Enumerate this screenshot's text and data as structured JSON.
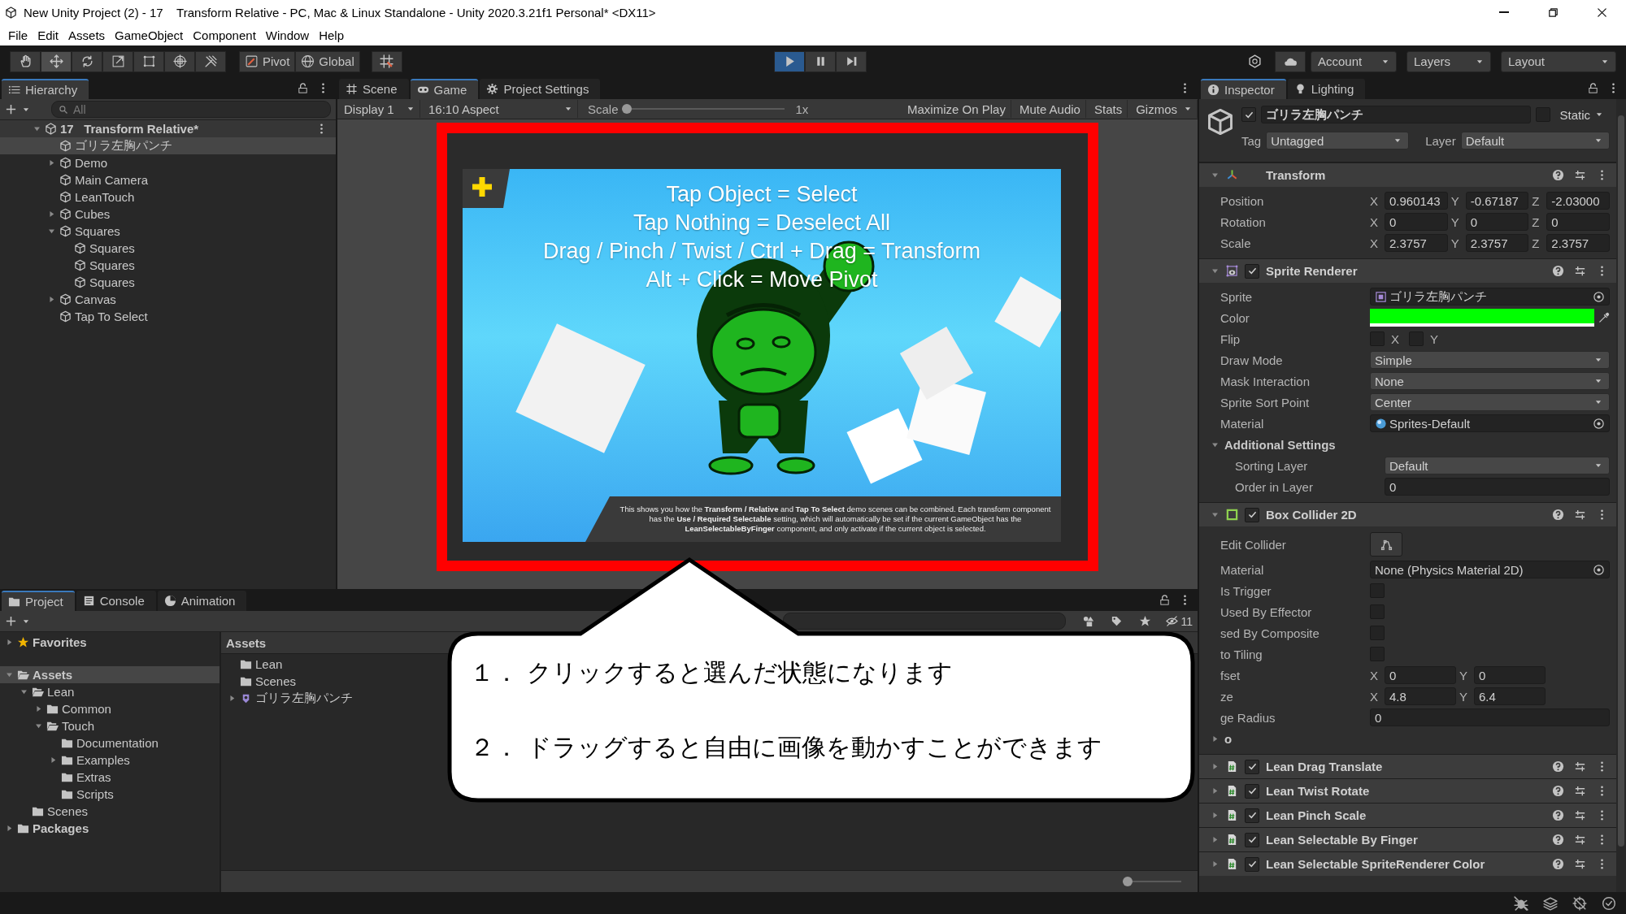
{
  "window": {
    "title": "New Unity Project (2) - 17    Transform Relative - PC, Mac & Linux Standalone - Unity 2020.3.21f1 Personal* <DX11>"
  },
  "menu": [
    "File",
    "Edit",
    "Assets",
    "GameObject",
    "Component",
    "Window",
    "Help"
  ],
  "toolbar": {
    "tools": [
      {
        "kind": "hand",
        "selected": false
      },
      {
        "kind": "move",
        "selected": true
      },
      {
        "kind": "rotate",
        "selected": false
      },
      {
        "kind": "scale",
        "selected": false
      },
      {
        "kind": "rect",
        "selected": false
      },
      {
        "kind": "transform",
        "selected": false
      },
      {
        "kind": "tools",
        "selected": false
      }
    ],
    "pivot": "Pivot",
    "global": "Global",
    "playing": true,
    "account": "Account",
    "layers": "Layers",
    "layout": "Layout"
  },
  "hierarchy": {
    "tab": "Hierarchy",
    "search": {
      "placeholder": "All"
    },
    "scene": {
      "name": "17   Transform Relative*",
      "expanded": true
    },
    "items": [
      {
        "name": "ゴリラ左胸パンチ",
        "selected": true
      },
      {
        "name": "Demo",
        "expanded": false,
        "selected": false
      },
      {
        "name": "Main Camera",
        "selected": false
      },
      {
        "name": "LeanTouch",
        "selected": false
      },
      {
        "name": "Cubes",
        "expanded": false,
        "selected": false
      },
      {
        "name": "Squares",
        "expanded": true,
        "selected": false,
        "children": [
          {
            "name": "Squares",
            "selected": false
          },
          {
            "name": "Squares",
            "selected": false
          },
          {
            "name": "Squares",
            "selected": false
          }
        ]
      },
      {
        "name": "Canvas",
        "expanded": false,
        "selected": false
      },
      {
        "name": "Tap To Select",
        "selected": false
      }
    ]
  },
  "view": {
    "tabs": [
      {
        "label": "Scene",
        "kind": "scene",
        "selected": false
      },
      {
        "label": "Game",
        "kind": "game",
        "selected": true
      },
      {
        "label": "Project Settings",
        "kind": "settings",
        "selected": false
      }
    ],
    "display": "Display 1",
    "aspect": "16:10 Aspect",
    "scale": {
      "label": "Scale",
      "level": 0,
      "reading": "1x"
    },
    "toggles": [
      {
        "label": "Maximize On Play",
        "on": false
      },
      {
        "label": "Mute Audio",
        "on": false
      },
      {
        "label": "Stats",
        "on": false
      },
      {
        "label": "Gizmos",
        "on": false
      }
    ],
    "game": {
      "headline": [
        "Tap Object = Select",
        "Tap Nothing = Deselect All",
        "Drag / Pinch / Twist / Ctrl + Drag = Transform",
        "Alt + Click = Move Pivot"
      ],
      "info": "This shows you how the **Transform / Relative** and **Tap To Select** demo scenes can be combined. Each transform component has the **Use / Required Selectable** setting, which will automatically be set if the current GameObject has the **LeanSelectableByFinger** component, and only activate if the current object is selected."
    }
  },
  "project": {
    "tabs": [
      {
        "label": "Project",
        "kind": "folder",
        "selected": true
      },
      {
        "label": "Console",
        "kind": "console",
        "selected": false
      },
      {
        "label": "Animation",
        "kind": "clock",
        "selected": false
      }
    ],
    "hidden_count": "11",
    "tree": [
      {
        "name": "Favorites",
        "kind": "favorites",
        "expanded": false,
        "selected": false
      },
      {
        "name": "Assets",
        "kind": "folder",
        "expanded": true,
        "selected": true,
        "children": [
          {
            "name": "Lean",
            "kind": "folder",
            "expanded": true,
            "selected": false,
            "children": [
              {
                "name": "Common",
                "kind": "folder",
                "expanded": false,
                "selected": false
              },
              {
                "name": "Touch",
                "kind": "folder",
                "expanded": true,
                "selected": false,
                "children": [
                  {
                    "name": "Documentation",
                    "kind": "folder",
                    "selected": false
                  },
                  {
                    "name": "Examples",
                    "kind": "folder",
                    "expanded": false,
                    "selected": false
                  },
                  {
                    "name": "Extras",
                    "kind": "folder",
                    "selected": false
                  },
                  {
                    "name": "Scripts",
                    "kind": "folder",
                    "selected": false
                  }
                ]
              }
            ]
          },
          {
            "name": "Scenes",
            "kind": "folder",
            "selected": false
          }
        ]
      },
      {
        "name": "Packages",
        "kind": "folder",
        "expanded": false,
        "selected": false
      }
    ],
    "breadcrumb": "Assets",
    "assets": [
      {
        "name": "Lean",
        "kind": "folder"
      },
      {
        "name": "Scenes",
        "kind": "folder"
      },
      {
        "name": "ゴリラ左胸パンチ",
        "kind": "sprite",
        "expanded": false
      }
    ],
    "zoom": {
      "level": 0
    }
  },
  "inspector": {
    "tabs": [
      {
        "label": "Inspector",
        "kind": "info",
        "selected": true
      },
      {
        "label": "Lighting",
        "kind": "bulb",
        "selected": false
      }
    ],
    "object": {
      "active": true,
      "name": "ゴリラ左胸パンチ",
      "static": false,
      "static_label": "Static",
      "tag_label": "Tag",
      "tag": "Untagged",
      "layer_label": "Layer",
      "layer": "Default"
    },
    "components": [
      {
        "name": "Transform",
        "kind": "transform",
        "expanded": true,
        "properties": [
          {
            "label": "Position",
            "kind": "vector",
            "fields": [
              {
                "axis": "X",
                "value": "0.960143"
              },
              {
                "axis": "Y",
                "value": "-0.67187"
              },
              {
                "axis": "Z",
                "value": "-2.03000"
              }
            ]
          },
          {
            "label": "Rotation",
            "kind": "vector",
            "fields": [
              {
                "axis": "X",
                "value": "0"
              },
              {
                "axis": "Y",
                "value": "0"
              },
              {
                "axis": "Z",
                "value": "0"
              }
            ]
          },
          {
            "label": "Scale",
            "kind": "vector",
            "fields": [
              {
                "axis": "X",
                "value": "2.3757"
              },
              {
                "axis": "Y",
                "value": "2.3757"
              },
              {
                "axis": "Z",
                "value": "2.3757"
              }
            ]
          }
        ]
      },
      {
        "name": "Sprite Renderer",
        "kind": "sprite",
        "enabled": true,
        "expanded": true,
        "properties": [
          {
            "label": "Sprite",
            "kind": "sprite",
            "value": "ゴリラ左胸パンチ"
          },
          {
            "label": "Color",
            "kind": "color",
            "color": "#00ff00"
          },
          {
            "label": "Flip",
            "kind": "flags",
            "flags": [
              {
                "label": "X",
                "checked": false
              },
              {
                "label": "Y",
                "checked": false
              }
            ]
          },
          {
            "label": "Draw Mode",
            "kind": "dropdown",
            "value": "Simple"
          },
          {
            "label": "Mask Interaction",
            "kind": "dropdown",
            "value": "None"
          },
          {
            "label": "Sprite Sort Point",
            "kind": "dropdown",
            "value": "Center"
          },
          {
            "label": "Material",
            "kind": "material",
            "value": "Sprites-Default"
          },
          {
            "label": "Additional Settings",
            "kind": "foldout",
            "expanded": true,
            "children": [
              {
                "label": "Sorting Layer",
                "kind": "dropdown",
                "value": "Default"
              },
              {
                "label": "Order in Layer",
                "kind": "number",
                "value": "0"
              }
            ]
          }
        ]
      },
      {
        "name": "Box Collider 2D",
        "kind": "collider",
        "enabled": true,
        "expanded": true,
        "properties": [
          {
            "label": "Edit Collider",
            "kind": "button"
          },
          {
            "label": "Material",
            "kind": "object",
            "value": "None (Physics Material 2D)"
          },
          {
            "label": "Is Trigger",
            "kind": "checkbox",
            "checked": false
          },
          {
            "label": "Used By Effector",
            "kind": "checkbox",
            "checked": false
          },
          {
            "label": "sed By Composite",
            "kind": "checkbox",
            "checked": false
          },
          {
            "label": "to Tiling",
            "kind": "checkbox",
            "checked": false
          },
          {
            "label": "fset",
            "kind": "vector",
            "fields": [
              {
                "axis": "X",
                "value": "0"
              },
              {
                "axis": "Y",
                "value": "0"
              }
            ]
          },
          {
            "label": "ze",
            "kind": "vector",
            "fields": [
              {
                "axis": "X",
                "value": "4.8"
              },
              {
                "axis": "Y",
                "value": "6.4"
              }
            ]
          },
          {
            "label": "ge Radius",
            "kind": "number",
            "value": "0"
          },
          {
            "label": "o",
            "kind": "foldout",
            "expanded": false
          }
        ]
      },
      {
        "name": "Lean Drag Translate",
        "kind": "script",
        "enabled": true,
        "expanded": false
      },
      {
        "name": "Lean Twist Rotate",
        "kind": "script",
        "enabled": true,
        "expanded": false
      },
      {
        "name": "Lean Pinch Scale",
        "kind": "script",
        "enabled": true,
        "expanded": false
      },
      {
        "name": "Lean Selectable By Finger",
        "kind": "script",
        "enabled": true,
        "expanded": false
      },
      {
        "name": "Lean Selectable SpriteRenderer Color",
        "kind": "script",
        "enabled": true,
        "expanded": false
      }
    ]
  },
  "callout": [
    "１． クリックすると選んだ状態になります",
    "２． ドラッグすると自由に画像を動かすことができます"
  ]
}
